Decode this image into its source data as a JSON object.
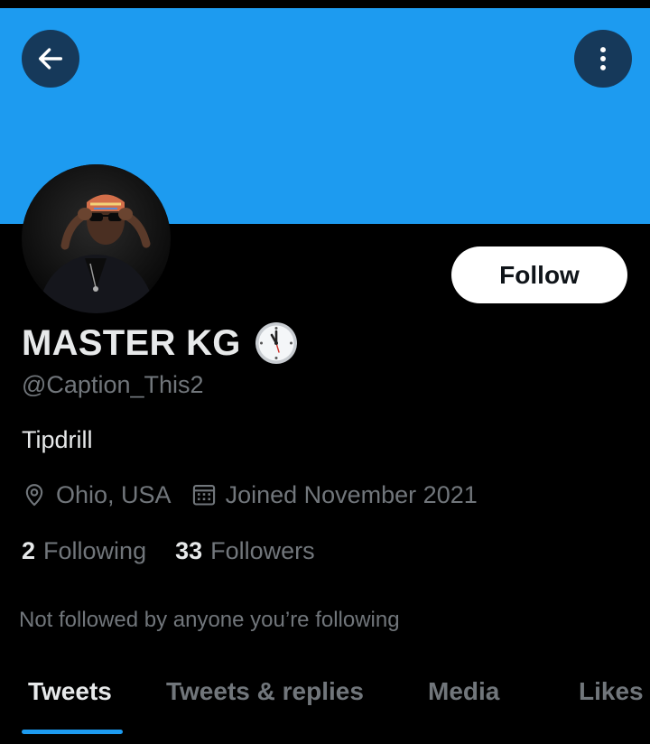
{
  "header": {
    "back_icon": "arrow-left-icon",
    "more_icon": "more-vertical-icon",
    "banner_color": "#1d9bf0"
  },
  "profile": {
    "display_name": "MASTER KG",
    "name_emoji": "clock-icon",
    "handle": "@Caption_This2",
    "bio": "Tipdrill",
    "location": "Ohio, USA",
    "joined": "Joined November 2021",
    "following_count": "2",
    "following_label": "Following",
    "followers_count": "33",
    "followers_label": "Followers",
    "mutuals_note": "Not followed by anyone you’re following"
  },
  "actions": {
    "follow_label": "Follow"
  },
  "tabs": [
    {
      "label": "Tweets",
      "active": true
    },
    {
      "label": "Tweets & replies",
      "active": false
    },
    {
      "label": "Media",
      "active": false
    },
    {
      "label": "Likes",
      "active": false
    }
  ],
  "colors": {
    "accent": "#1d9bf0",
    "background": "#000000",
    "primary_text": "#e7e9ea",
    "secondary_text": "#71767b"
  }
}
